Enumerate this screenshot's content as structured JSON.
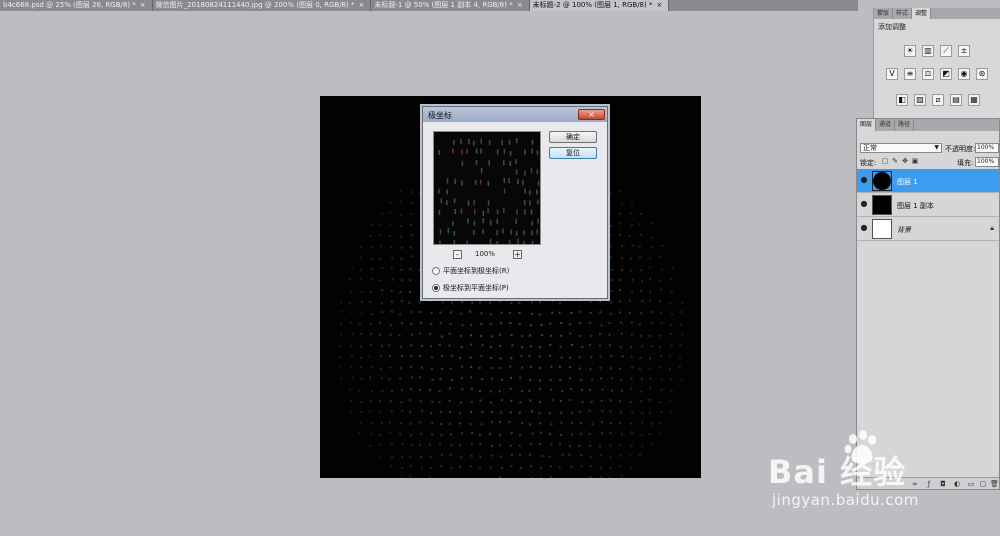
{
  "doc_tabs": [
    {
      "label": "b4c668.psd @ 25% (图层 26, RGB/8) *",
      "active": false
    },
    {
      "label": "微信图片_20180824111440.jpg @ 200% (图层 0, RGB/8) *",
      "active": false
    },
    {
      "label": "未标题-1 @ 50% (图层 1 副本 4, RGB/8) *",
      "active": false
    },
    {
      "label": "未标题-2 @ 100% (图层 1, RGB/8) *",
      "active": true
    }
  ],
  "tab_close_glyph": "×",
  "dialog": {
    "title": "极坐标",
    "close_glyph": "×",
    "ok_label": "确定",
    "reset_label": "复位",
    "zoom_value": "100%",
    "zoom_minus": "-",
    "zoom_plus": "+",
    "option_rect_to_polar": "平面坐标到极坐标(R)",
    "option_polar_to_rect": "极坐标到平面坐标(P)",
    "selected_option": "polar_to_rect"
  },
  "adjust_panel": {
    "tabs": [
      "蒙版",
      "样式",
      "调整"
    ],
    "active_tab": "调整",
    "title": "添加调整"
  },
  "layers_panel": {
    "tabs": [
      "图层",
      "通道",
      "路径"
    ],
    "active_tab": "图层",
    "blend_mode": "正常",
    "opacity_label": "不透明度:",
    "opacity_value": "100%",
    "lock_label": "锁定:",
    "fill_label": "填充:",
    "fill_value": "100%",
    "layers": [
      {
        "name": "图层 1",
        "selected": true,
        "thumb": "black-circle",
        "visible": true
      },
      {
        "name": "图层 1 副本",
        "selected": false,
        "thumb": "black",
        "visible": true
      },
      {
        "name": "背景",
        "selected": false,
        "thumb": "white",
        "visible": true,
        "locked": true
      }
    ]
  },
  "watermark": {
    "logo": "Bai  经验",
    "url": "jingyan.baidu.com"
  },
  "colors": {
    "selection_blue": "#3c9cf0",
    "canvas_black": "#020202",
    "workspace_gray": "#bdbcc0"
  }
}
